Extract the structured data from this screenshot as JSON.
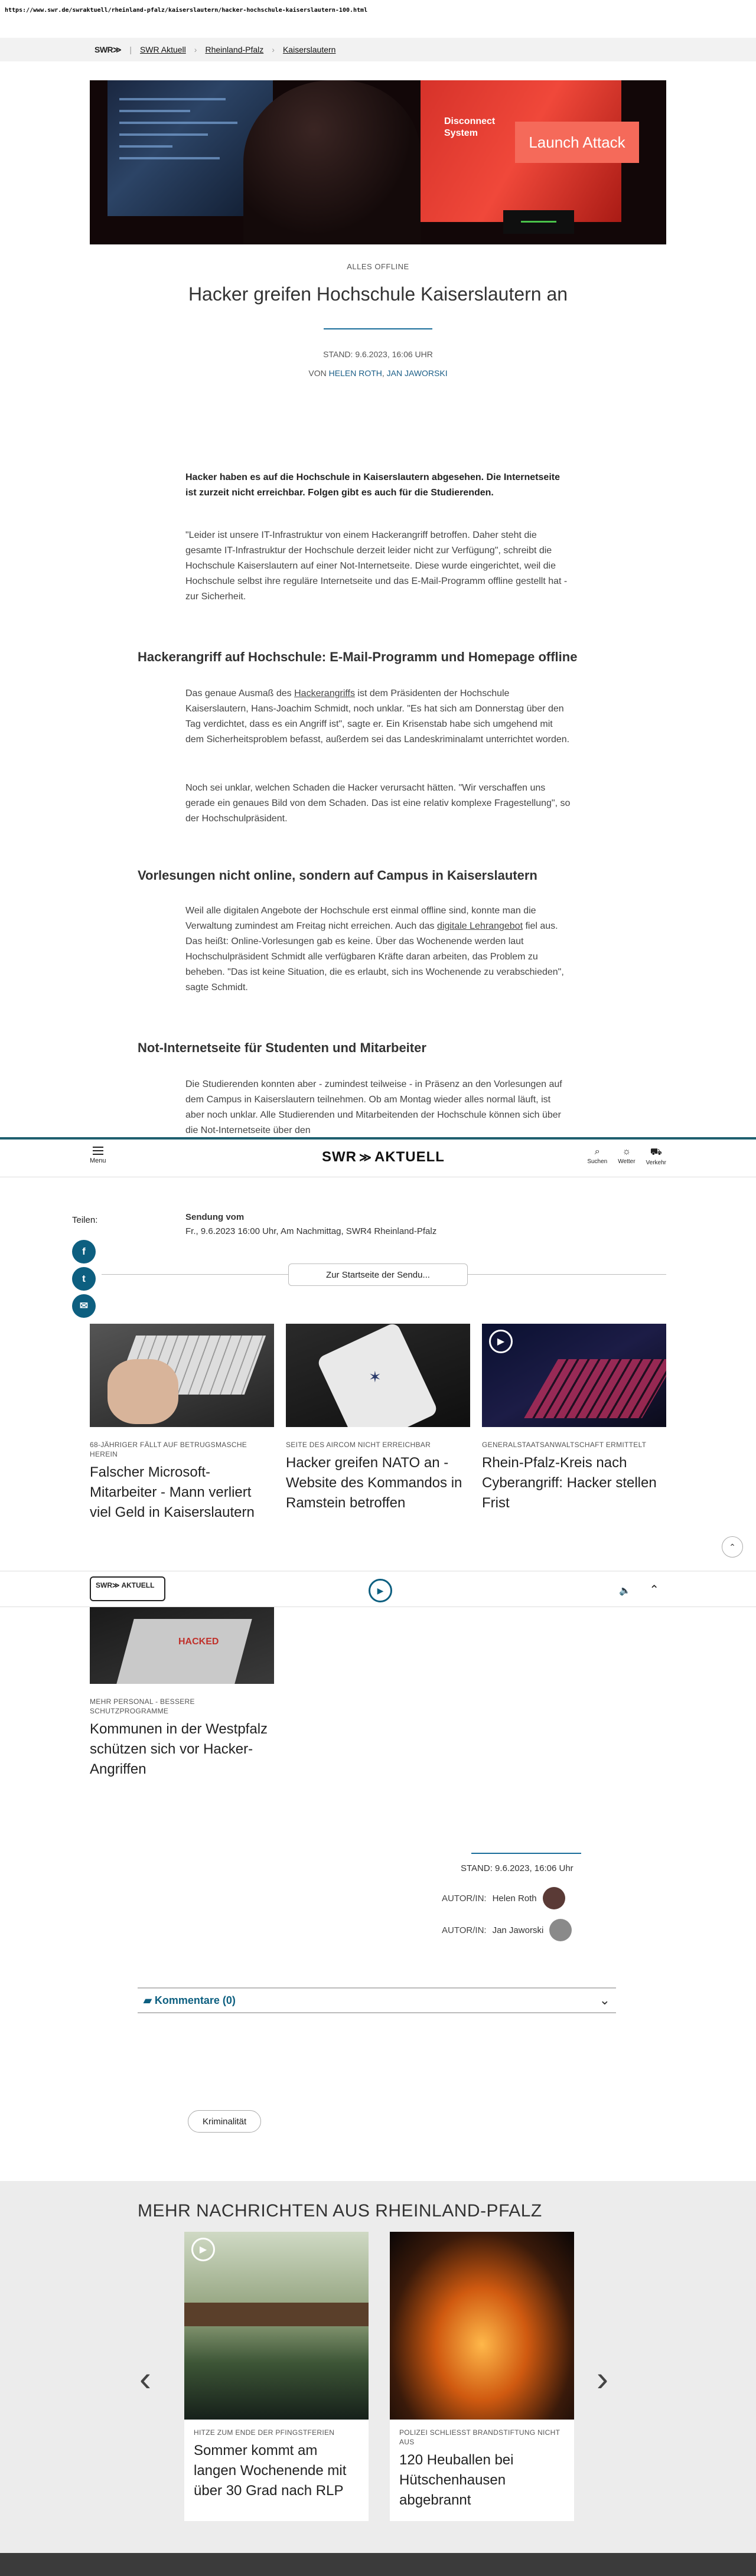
{
  "url": "https://www.swr.de/swraktuell/rheinland-pfalz/kaiserslautern/hacker-hochschule-kaiserslautern-100.html",
  "breadcrumb": {
    "logo": "SWR≫",
    "items": [
      "SWR Aktuell",
      "Rheinland-Pfalz",
      "Kaiserslautern"
    ]
  },
  "hero": {
    "button_text": "Launch Attack",
    "screen_text_1": "Disconnect",
    "screen_text_2": "System"
  },
  "article": {
    "kicker": "ALLES OFFLINE",
    "title": "Hacker greifen Hochschule Kaiserslautern an",
    "stand": "STAND: 9.6.2023, 16:06 UHR",
    "von_prefix": "VON",
    "author1": "HELEN ROTH",
    "author2": "JAN JAWORSKI",
    "lead": "Hacker haben es auf die Hochschule in Kaiserslautern abgesehen. Die Internetseite ist zurzeit nicht erreichbar. Folgen gibt es auch für die Studierenden.",
    "p1": "\"Leider ist unsere IT-Infrastruktur von einem Hackerangriff betroffen. Daher steht die gesamte IT-Infrastruktur der Hochschule derzeit leider nicht zur Verfügung\", schreibt die Hochschule Kaiserslautern auf einer Not-Internetseite. Diese wurde eingerichtet, weil die Hochschule selbst ihre reguläre Internetseite und das E-Mail-Programm offline gestellt hat - zur Sicherheit.",
    "h1": "Hackerangriff auf Hochschule: E-Mail-Programm und Homepage offline",
    "p2a": "Das genaue Ausmaß des ",
    "p2link": "Hackerangriffs",
    "p2b": " ist dem Präsidenten der Hochschule Kaiserslautern, Hans-Joachim Schmidt, noch unklar. \"Es hat sich am Donnerstag über den Tag verdichtet, dass es ein Angriff ist\", sagte er. Ein Krisenstab habe sich umgehend mit dem Sicherheitsproblem befasst, außerdem sei das Landeskriminalamt unterrichtet worden.",
    "p3": "Noch sei unklar, welchen Schaden die Hacker verursacht hätten. \"Wir verschaffen uns gerade ein genaues Bild von dem Schaden. Das ist eine relativ komplexe Fragestellung\", so der Hochschulpräsident.",
    "h2": "Vorlesungen nicht online, sondern auf Campus in Kaiserslautern",
    "p4a": "Weil alle digitalen Angebote der Hochschule erst einmal offline sind, konnte man die Verwaltung zumindest am Freitag nicht erreichen. Auch das ",
    "p4link": "digitale Lehrangebot",
    "p4b": " fiel aus. Das heißt: Online-Vorlesungen gab es keine. Über das Wochenende werden laut Hochschulpräsident Schmidt alle verfügbaren Kräfte daran arbeiten, das Problem zu beheben. \"Das ist keine Situation, die es erlaubt, sich ins Wochenende zu verabschieden\", sagte Schmidt.",
    "h3": "Not-Internetseite für Studenten und Mitarbeiter",
    "p5": "Die Studierenden konnten aber - zumindest teilweise - in Präsenz an den Vorlesungen auf dem Campus in Kaiserslautern teilnehmen. Ob am Montag wieder alles normal läuft, ist aber noch unklar. Alle Studierenden und Mitarbeitenden der Hochschule können sich über die Not-Internetseite über den"
  },
  "header": {
    "menu": "Menu",
    "logo_left": "SWR",
    "logo_arrows": "≫",
    "logo_right": "AKTUELL",
    "icons": [
      {
        "glyph": "⌕",
        "label": "Suchen"
      },
      {
        "glyph": "☼",
        "label": "Wetter"
      },
      {
        "glyph": "⛟",
        "label": "Verkehr"
      }
    ]
  },
  "share": {
    "label": "Teilen:",
    "fb": "f",
    "tw": "t",
    "mail": "✉"
  },
  "sendung": {
    "title": "Sendung vom",
    "detail": "Fr., 9.6.2023 16:00 Uhr, Am Nachmittag, SWR4 Rheinland-Pfalz",
    "button": "Zur Startseite der Sendu..."
  },
  "related": [
    {
      "cat": "68-JÄHRIGER FÄLLT AUF BETRUGSMASCHE HEREIN",
      "title": "Falscher Microsoft-Mitarbeiter - Mann verliert viel Geld in Kaiserslautern"
    },
    {
      "cat": "SEITE DES AIRCOM NICHT ERREICHBAR",
      "title": "Hacker greifen NATO an - Website des Kommandos in Ramstein betroffen"
    },
    {
      "cat": "GENERALSTAATSANWALTSCHAFT ERMITTELT",
      "title": "Rhein-Pfalz-Kreis nach Cyberangriff: Hacker stellen Frist"
    },
    {
      "cat": "MEHR PERSONAL - BESSERE SCHUTZPROGRAMME",
      "title": "Kommunen in der Westpfalz schützen sich vor Hacker-Angriffen",
      "img_text": "HACKED"
    }
  ],
  "player": {
    "logo": "SWR≫ AKTUELL"
  },
  "meta": {
    "stand": "STAND: 9.6.2023, 16:06 Uhr",
    "author_label": "AUTOR/IN:",
    "author1": "Helen Roth",
    "author2": "Jan Jaworski"
  },
  "comments": {
    "label": "Kommentare (0)"
  },
  "tag": "Kriminalität",
  "more": {
    "heading": "MEHR NACHRICHTEN AUS RHEINLAND-PFALZ",
    "cards": [
      {
        "cat": "HITZE ZUM ENDE DER PFINGSTFERIEN",
        "title": "Sommer kommt am langen Wochenende mit über 30 Grad nach RLP"
      },
      {
        "cat": "POLIZEI SCHLIESST BRANDSTIFTUNG NICHT AUS",
        "title": "120 Heuballen bei Hütschenhausen abgebrannt"
      }
    ]
  }
}
